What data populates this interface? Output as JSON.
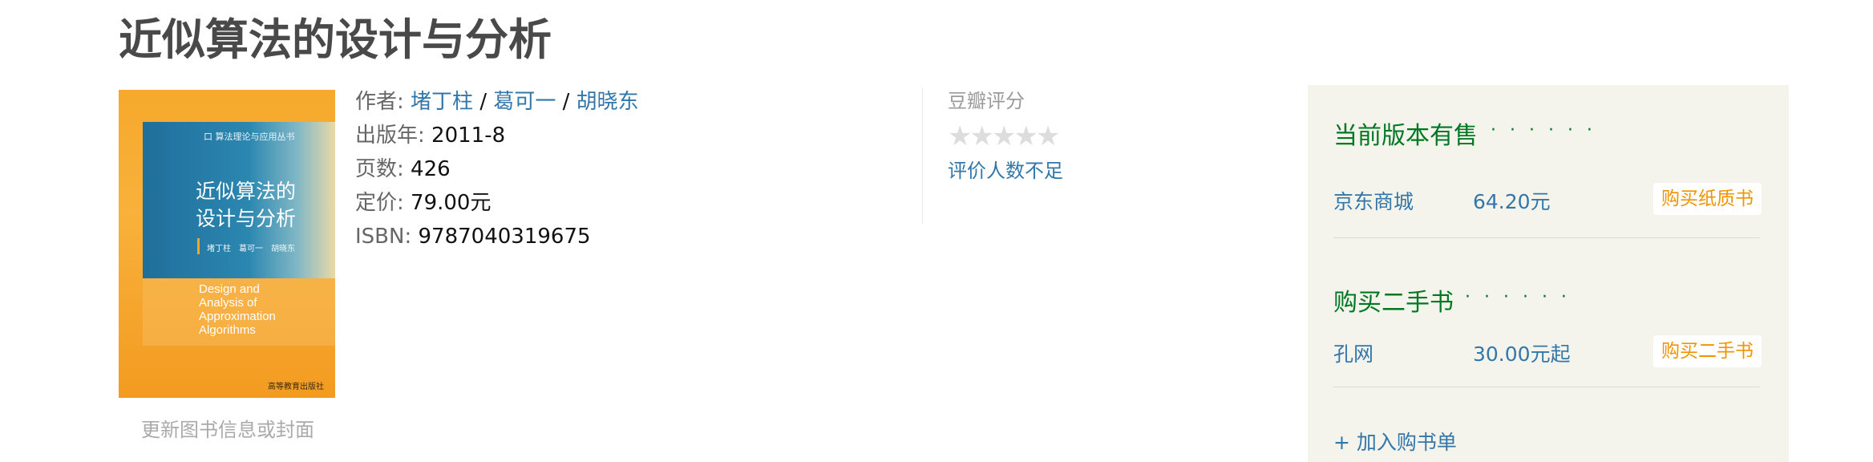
{
  "book": {
    "title": "近似算法的设计与分析",
    "cover": {
      "series": "口 算法理论与应用丛书",
      "title_line1": "近似算法的",
      "title_line2": "设计与分析",
      "authors": "堵丁柱　葛可一　胡晓东",
      "en_line1": "Design and",
      "en_line2": "Analysis of",
      "en_line3": "Approximation",
      "en_line4": "Algorithms",
      "publisher": "高等教育出版社"
    },
    "update_link": "更新图书信息或封面",
    "info": {
      "author_label": "作者:",
      "authors": [
        "堵丁柱",
        "葛可一",
        "胡晓东"
      ],
      "separator": "/",
      "year_label": "出版年:",
      "year": "2011-8",
      "pages_label": "页数:",
      "pages": "426",
      "price_label": "定价:",
      "price": "79.00元",
      "isbn_label": "ISBN:",
      "isbn": "9787040319675"
    }
  },
  "rating": {
    "label": "豆瓣评分",
    "stars": "★★★★★",
    "note": "评价人数不足"
  },
  "buy": {
    "current": {
      "title": "当前版本有售",
      "dots": "· · · · · ·",
      "store": "京东商城",
      "price": "64.20元",
      "button": "购买纸质书"
    },
    "secondhand": {
      "title": "购买二手书",
      "dots": "· · · · · ·",
      "store": "孔网",
      "price": "30.00元起",
      "button": "购买二手书"
    },
    "add_list": "+ 加入购书单"
  },
  "colors": {
    "link": "#3377aa",
    "green": "#007722",
    "orange": "#ef9400",
    "panel_bg": "#f4f4ec"
  }
}
